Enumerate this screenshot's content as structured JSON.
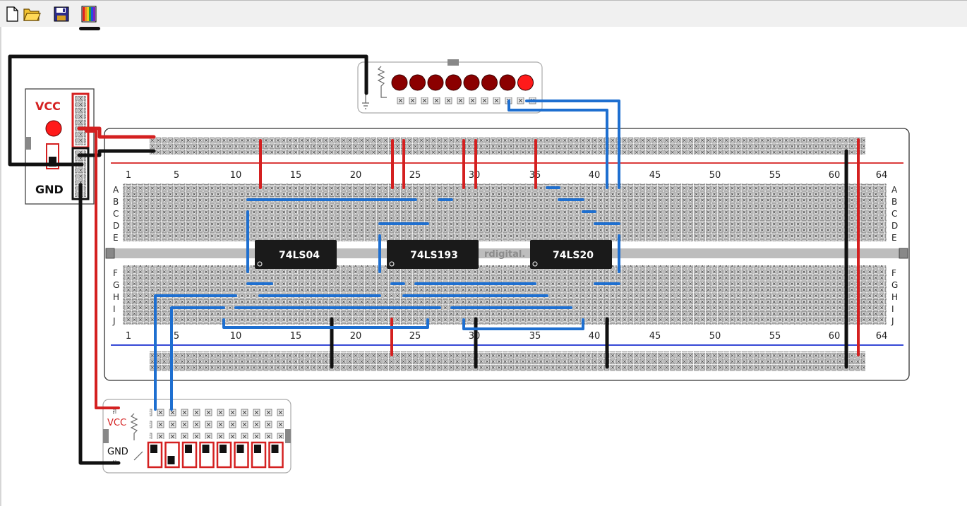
{
  "toolbar": {
    "items": [
      {
        "name": "new-file-icon",
        "title": "New"
      },
      {
        "name": "open-folder-icon",
        "title": "Open"
      },
      {
        "name": "save-icon",
        "title": "Save"
      },
      {
        "name": "wire-colors-icon",
        "title": "Wire colors",
        "active": true
      }
    ]
  },
  "power_supply": {
    "vcc_label": "VCC",
    "gnd_label": "GND"
  },
  "breadboard": {
    "rows_top": [
      "A",
      "B",
      "C",
      "D",
      "E"
    ],
    "rows_bottom": [
      "F",
      "G",
      "H",
      "I",
      "J"
    ],
    "column_numbers": [
      "1",
      "5",
      "10",
      "15",
      "20",
      "25",
      "30",
      "35",
      "40",
      "45",
      "50",
      "55",
      "60",
      "64"
    ],
    "watermark": "rdigital.",
    "rail_top_color": "#d42020",
    "rail_bottom_color": "#1a2fd0"
  },
  "chips": [
    {
      "name": "chip-74ls04",
      "label": "74LS04"
    },
    {
      "name": "chip-74ls193",
      "label": "74LS193"
    },
    {
      "name": "chip-74ls20",
      "label": "74LS20"
    }
  ],
  "led_bar": {
    "count": 8,
    "lit_index": 7,
    "lit_color": "#ff1a1a",
    "off_color": "#8b0000"
  },
  "dip_switch": {
    "vcc_label": "VCC",
    "gnd_label": "GND",
    "count": 8,
    "on_index": 1
  },
  "wire_colors": {
    "red": "#d42020",
    "black": "#111111",
    "blue": "#1e6fd0"
  }
}
